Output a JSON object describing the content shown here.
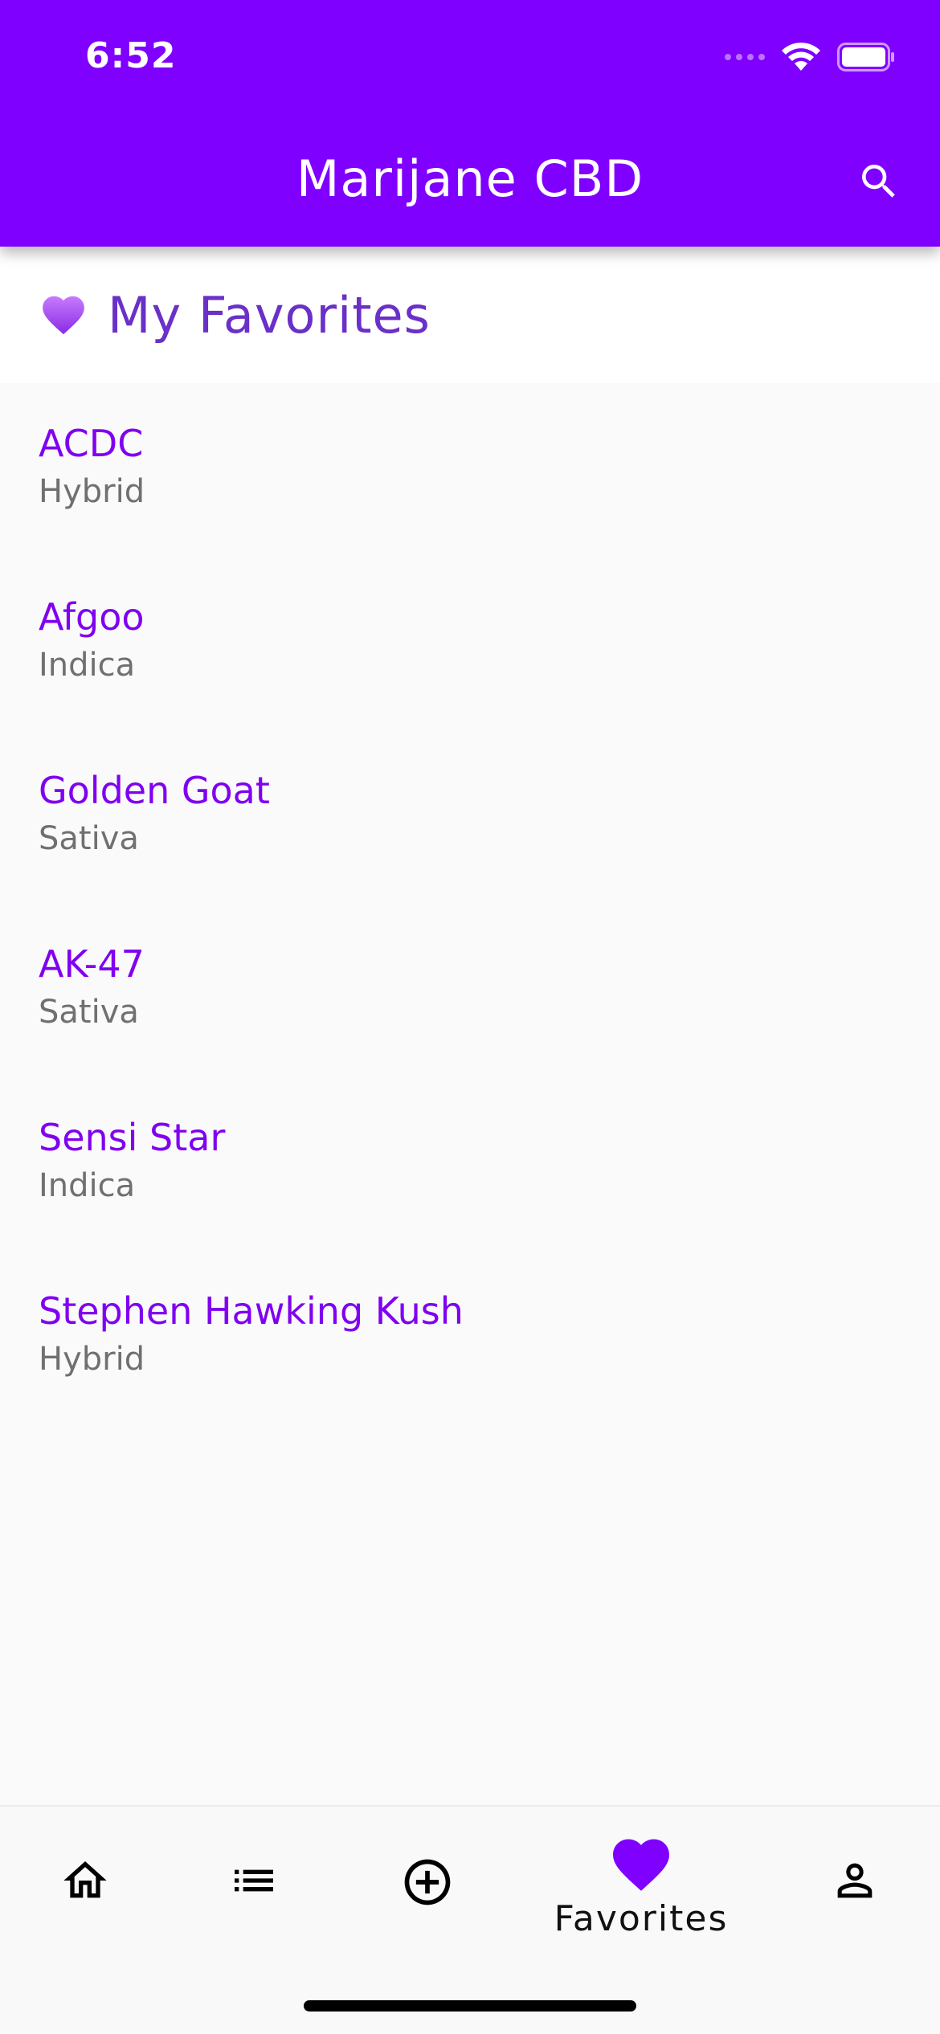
{
  "status_bar": {
    "time": "6:52"
  },
  "app_bar": {
    "title": "Marijane CBD",
    "icons": {
      "search": "search-icon"
    }
  },
  "section": {
    "icon": "purple-heart-emoji",
    "title": "My Favorites"
  },
  "favorites": [
    {
      "name": "ACDC",
      "type": "Hybrid"
    },
    {
      "name": "Afgoo",
      "type": "Indica"
    },
    {
      "name": "Golden Goat",
      "type": "Sativa"
    },
    {
      "name": "AK-47",
      "type": "Sativa"
    },
    {
      "name": "Sensi Star",
      "type": "Indica"
    },
    {
      "name": "Stephen Hawking Kush",
      "type": "Hybrid"
    }
  ],
  "bottom_nav": {
    "items": [
      {
        "icon": "home-icon"
      },
      {
        "icon": "list-icon"
      },
      {
        "icon": "add-circle-icon"
      },
      {
        "icon": "heart-icon",
        "label": "Favorites",
        "active": true
      },
      {
        "icon": "person-icon"
      }
    ]
  },
  "colors": {
    "primary": "#8000ff",
    "item_title": "#8000f0",
    "section_title": "#6a30c8",
    "subtitle": "#707070",
    "background": "#fafafa"
  }
}
